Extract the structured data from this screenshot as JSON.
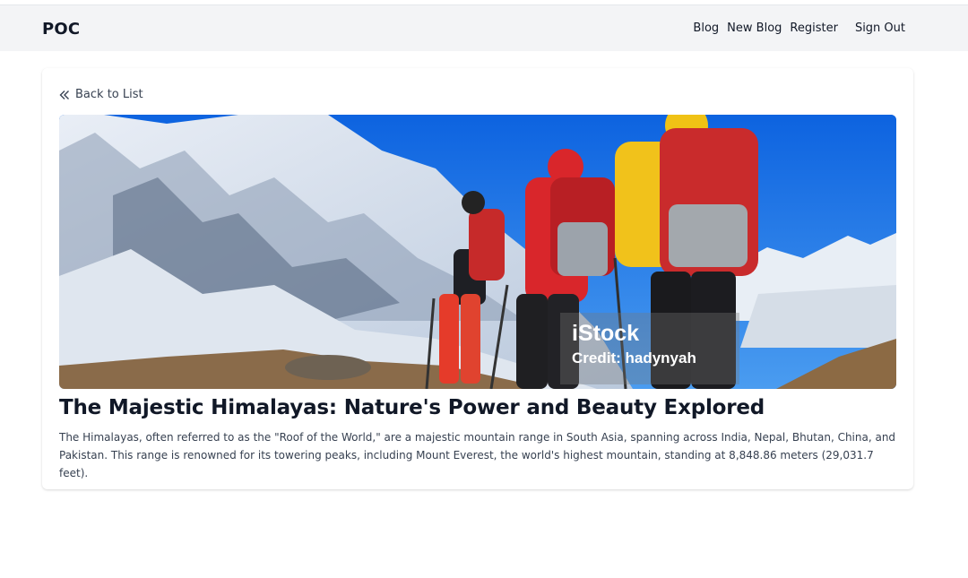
{
  "navbar": {
    "brand": "POC",
    "links": [
      "Blog",
      "New Blog",
      "Register"
    ],
    "signout": "Sign Out"
  },
  "post": {
    "back_label": "Back to List",
    "image": {
      "watermark_brand": "iStock",
      "watermark_credit": "Credit: hadynyah"
    },
    "title": "The Majestic Himalayas: Nature's Power and Beauty Explored",
    "body": "The Himalayas, often referred to as the \"Roof of the World,\" are a majestic mountain range in South Asia, spanning across India, Nepal, Bhutan, China, and Pakistan. This range is renowned for its towering peaks, including Mount Everest, the world's highest mountain, standing at 8,848.86 meters (29,031.7 feet)."
  },
  "colors": {
    "navbar_bg": "#f3f4f6",
    "text": "#111827",
    "muted_text": "#374151",
    "sky": "#1e6fd9"
  },
  "icons": {
    "back": "double-chevron-left-icon"
  }
}
